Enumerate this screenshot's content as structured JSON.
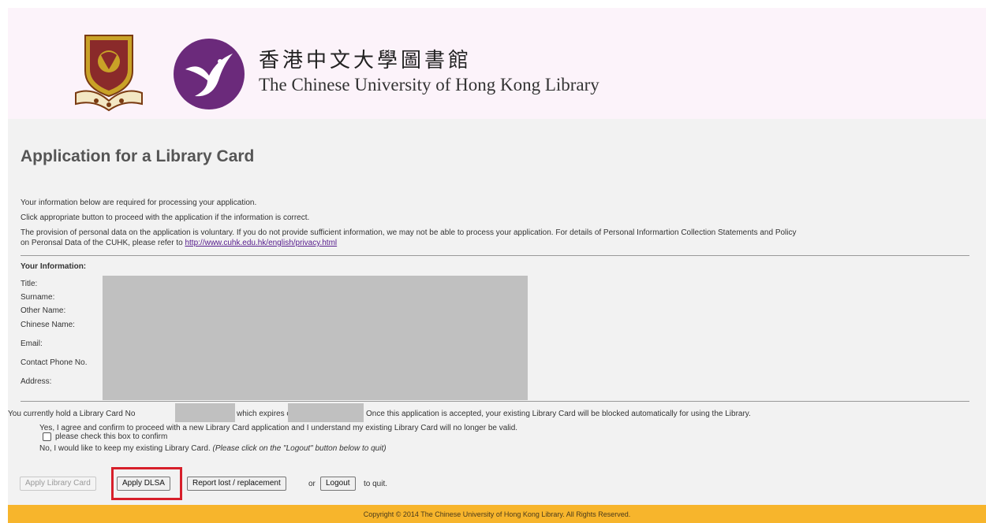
{
  "header": {
    "name_zh": "香港中文大學圖書館",
    "name_en": "The Chinese University of Hong Kong Library"
  },
  "page": {
    "title": "Application for a Library Card",
    "intro_1": "Your information below are required for processing your application.",
    "intro_2": "Click appropriate button to proceed with the application if the information is correct.",
    "privacy_1": "The provision of personal data on the application is voluntary. If you do not provide sufficient information, we may not be able to process your application. For details of Personal Informartion Collection Statements and Policy",
    "privacy_2_prefix": "on Peronsal Data of the CUHK, please refer to ",
    "privacy_link": "http://www.cuhk.edu.hk/english/privacy.html"
  },
  "info": {
    "heading": "Your Information:",
    "fields": {
      "title": "Title:",
      "surname": "Surname:",
      "other_name": "Other Name:",
      "chinese_name": "Chinese Name:",
      "email": "Email:",
      "phone": "Contact Phone No.",
      "address": "Address:"
    }
  },
  "card": {
    "text_1": "You currently hold a Library Card No",
    "text_2": "which expires on",
    "text_3": "Once this application is accepted, your existing Library Card will be blocked automatically for using the Library."
  },
  "confirm": {
    "yes_text": "Yes, I agree and confirm to proceed with a new Library Card application and I understand my existing Library Card will no longer be valid.",
    "checkbox_label": "please check this box to confirm",
    "checkbox_checked": false,
    "no_text": "No, I would like to keep my existing Library Card. ",
    "no_hint": "(Please click on the \"Logout\" button below to quit)"
  },
  "actions": {
    "apply_card": "Apply Library Card",
    "apply_dlsa": "Apply DLSA",
    "report_lost": "Report lost / replacement",
    "or_text": "or",
    "logout": "Logout",
    "quit_text": "to quit."
  },
  "footer": {
    "copyright": "Copyright © 2014 The Chinese University of Hong Kong Library. All Rights Reserved."
  },
  "colors": {
    "header_bg": "#fcf3fa",
    "content_bg": "#f2f2f2",
    "footer_bg": "#f7b52c",
    "brand_purple": "#6b2a7b",
    "highlight_red": "#d71f2a"
  }
}
